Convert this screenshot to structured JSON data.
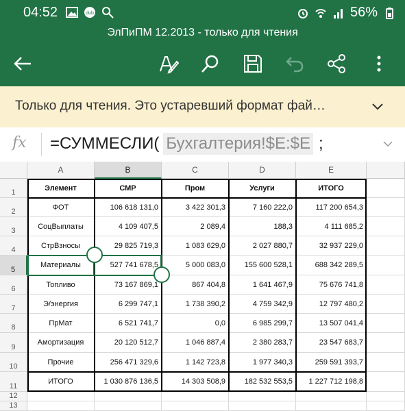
{
  "status": {
    "time": "04:52",
    "battery": "56%"
  },
  "title": "ЭлПиПМ 12.2013 - только для чтения",
  "banner": {
    "text": "Только для чтения. Это устаревший формат фай…"
  },
  "formula": {
    "fx": "fx",
    "prefix": "=СУММЕСЛИ(",
    "ref": "Бухгалтерия!$E:$E",
    "suffix": ";"
  },
  "columns": [
    "A",
    "B",
    "C",
    "D",
    "E"
  ],
  "rows": [
    "1",
    "2",
    "3",
    "4",
    "5",
    "6",
    "7",
    "8",
    "9",
    "10",
    "11",
    "12",
    "13"
  ],
  "table": {
    "headers": [
      "Элемент",
      "СМР",
      "Пром",
      "Услуги",
      "ИТОГО"
    ],
    "rows": [
      [
        "ФОТ",
        "106 618 131,0",
        "3 422 301,3",
        "7 160 222,0",
        "117 200 654,3"
      ],
      [
        "СоцВыплаты",
        "4 109 407,5",
        "2 089,4",
        "188,3",
        "4 111 685,2"
      ],
      [
        "СтрВзносы",
        "29 825 719,3",
        "1 083 629,0",
        "2 027 880,7",
        "32 937 229,0"
      ],
      [
        "Материалы",
        "527 741 678,5",
        "5 000 083,0",
        "155 600 528,1",
        "688 342 289,5"
      ],
      [
        "Топливо",
        "73 167 869,1",
        "867 404,8",
        "1 641 467,9",
        "75 676 741,8"
      ],
      [
        "Э/энергия",
        "6 299 747,1",
        "1 738 390,2",
        "4 759 342,9",
        "12 797 480,2"
      ],
      [
        "ПрМат",
        "6 521 741,7",
        "0,0",
        "6 985 299,7",
        "13 507 041,4"
      ],
      [
        "Амортизация",
        "20 120 512,7",
        "1 046 887,4",
        "2 380 283,7",
        "23 547 683,7"
      ],
      [
        "Прочие",
        "256 471 329,6",
        "1 142 723,8",
        "1 977 340,3",
        "259 591 393,7"
      ],
      [
        "ИТОГО",
        "1 030 876 136,5",
        "14 303 508,9",
        "182 532 553,5",
        "1 227 712 198,8"
      ]
    ]
  },
  "icons": {
    "back": "back-arrow-icon",
    "edit": "pen-format-icon",
    "search": "search-icon",
    "save": "save-icon",
    "undo": "undo-icon",
    "share": "share-icon",
    "more": "more-vert-icon"
  },
  "colors": {
    "accent": "#217346",
    "banner": "#fbf0cf"
  }
}
